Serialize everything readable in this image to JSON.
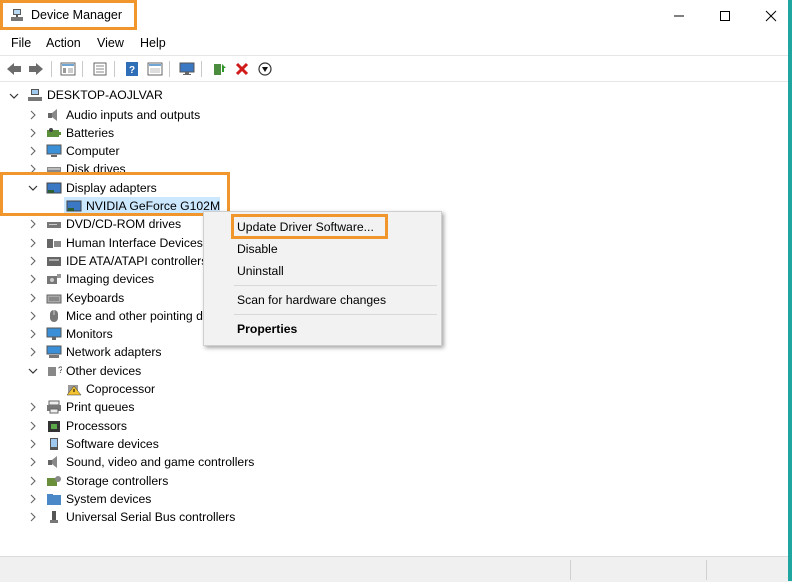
{
  "window": {
    "title": "Device Manager",
    "controls": {
      "minimize": "—",
      "maximize": "☐",
      "close": "✕"
    }
  },
  "menu": [
    "File",
    "Action",
    "View",
    "Help"
  ],
  "toolbar": [
    "back-icon",
    "forward-icon",
    "show-hide-tree-icon",
    "properties-icon",
    "help-icon",
    "view-icon",
    "monitor-icon",
    "update-driver-icon",
    "uninstall-icon",
    "enable-device-icon"
  ],
  "tree": {
    "root": "DESKTOP-AOJLVAR",
    "items": [
      {
        "label": "Audio inputs and outputs",
        "icon": "speaker-icon"
      },
      {
        "label": "Batteries",
        "icon": "battery-icon"
      },
      {
        "label": "Computer",
        "icon": "computer-icon"
      },
      {
        "label": "Disk drives",
        "icon": "disk-drive-icon"
      },
      {
        "label": "Display adapters",
        "icon": "display-adapter-icon",
        "expanded": true
      },
      {
        "label": "NVIDIA GeForce G102M",
        "icon": "display-adapter-icon",
        "child": true,
        "selected": true
      },
      {
        "label": "DVD/CD-ROM drives",
        "icon": "dvd-icon"
      },
      {
        "label": "Human Interface Devices",
        "icon": "hid-icon"
      },
      {
        "label": "IDE ATA/ATAPI controllers",
        "icon": "ide-icon"
      },
      {
        "label": "Imaging devices",
        "icon": "camera-icon"
      },
      {
        "label": "Keyboards",
        "icon": "keyboard-icon"
      },
      {
        "label": "Mice and other pointing devices",
        "icon": "mouse-icon"
      },
      {
        "label": "Monitors",
        "icon": "monitor-icon"
      },
      {
        "label": "Network adapters",
        "icon": "network-icon"
      },
      {
        "label": "Other devices",
        "icon": "other-devices-icon",
        "expanded": true
      },
      {
        "label": "Coprocessor",
        "icon": "warning-device-icon",
        "child": true
      },
      {
        "label": "Print queues",
        "icon": "printer-icon"
      },
      {
        "label": "Processors",
        "icon": "processor-icon"
      },
      {
        "label": "Software devices",
        "icon": "software-device-icon"
      },
      {
        "label": "Sound, video and game controllers",
        "icon": "speaker-icon"
      },
      {
        "label": "Storage controllers",
        "icon": "storage-icon"
      },
      {
        "label": "System devices",
        "icon": "system-folder-icon"
      },
      {
        "label": "Universal Serial Bus controllers",
        "icon": "usb-icon"
      }
    ]
  },
  "context_menu": {
    "items": [
      "Update Driver Software...",
      "Disable",
      "Uninstall",
      "Scan for hardware changes",
      "Properties"
    ]
  },
  "colors": {
    "highlight": "#f0962d",
    "selection": "#cce8ff"
  }
}
